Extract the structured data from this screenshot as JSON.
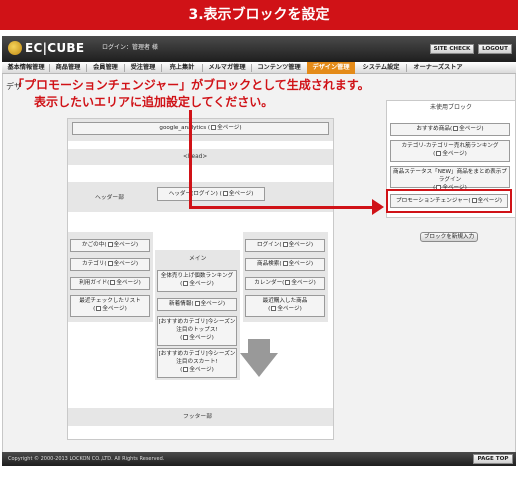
{
  "banner": {
    "title": "3.表示ブロックを設定"
  },
  "header": {
    "logo_text": "EC|CUBE",
    "login_text": "ログイン：管理者 様",
    "site_check_label": "SITE CHECK",
    "logout_label": "LOGOUT"
  },
  "nav": {
    "items": [
      {
        "label": "基本情報管理"
      },
      {
        "label": "商品管理"
      },
      {
        "label": "会員管理"
      },
      {
        "label": "受注管理"
      },
      {
        "label": "売上集計"
      },
      {
        "label": "メルマガ管理"
      },
      {
        "label": "コンテンツ管理"
      },
      {
        "label": "デザイン管理"
      },
      {
        "label": "システム設定"
      },
      {
        "label": "オーナーズストア"
      }
    ],
    "active": "デザイン管理"
  },
  "page": {
    "heading": "デザ"
  },
  "callout": {
    "line1": "「プロモーションチェンジャー」がブロックとして生成されます。",
    "line2": "表示したいエリアに追加設定してください。"
  },
  "canvas": {
    "top_block": "google_analytics",
    "all_pages": "全ページ",
    "head_label": "<head>",
    "header_label": "ヘッダー部",
    "header_block": "ヘッダー(ログイン)",
    "main_label": "メイン",
    "footer_label": "フッター部",
    "left_blocks": [
      {
        "name": "かごの中"
      },
      {
        "name": "カテゴリ"
      },
      {
        "name": "利用ガイド"
      },
      {
        "name": "最近チェックしたリスト"
      }
    ],
    "center_blocks": [
      {
        "name": "全体売り上げ個数ランキング"
      },
      {
        "name": "新着情報"
      },
      {
        "name": "[おすすめカテゴリ]今シーズン注目のトップス!"
      },
      {
        "name": "[おすすめカテゴリ]今シーズン注目のスカート!"
      }
    ],
    "right_blocks": [
      {
        "name": "ログイン"
      },
      {
        "name": "商品検索"
      },
      {
        "name": "カレンダー"
      },
      {
        "name": "最近購入した商品"
      }
    ]
  },
  "unused": {
    "title": "未使用ブロック",
    "blocks": [
      {
        "name": "おすすめ商品"
      },
      {
        "name": "カテゴリ-カテゴリー売れ筋ランキング"
      },
      {
        "name": "商品ステータス「NEW」商品をまとめ表示プラグイン"
      },
      {
        "name": "プロモーションチェンジャー"
      }
    ],
    "new_block_button": "ブロックを新規入力"
  },
  "footer": {
    "copyright": "Copyright © 2000-2013 LOCKON CO.,LTD. All Rights Reserved.",
    "page_top_label": "PAGE TOP"
  },
  "colors": {
    "accent_red": "#d01217",
    "nav_active": "#e48b19",
    "header_dark": "#2b2b2b"
  }
}
